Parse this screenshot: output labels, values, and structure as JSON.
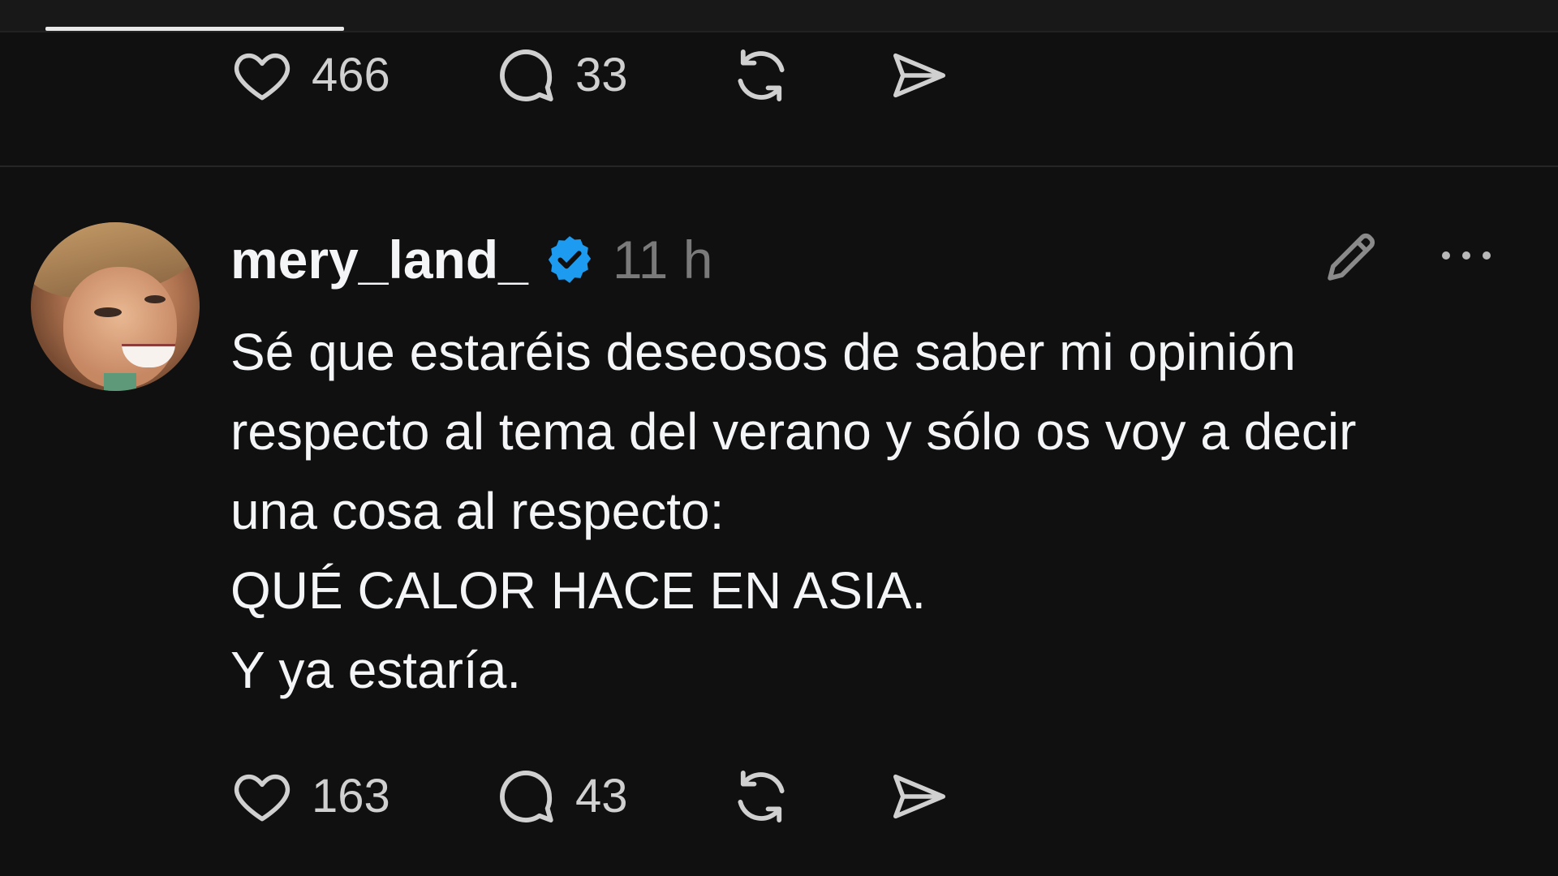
{
  "previous_post": {
    "likes": "466",
    "replies": "33"
  },
  "post": {
    "username": "mery_land_",
    "timestamp": "11 h",
    "lines": [
      "Sé que estaréis deseosos de saber mi opinión",
      "respecto al tema del verano y sólo os voy a decir",
      "una cosa al respecto:",
      "QUÉ CALOR HACE EN ASIA.",
      "Y ya estaría."
    ],
    "likes": "163",
    "replies": "43"
  },
  "icons": {
    "like": "heart-icon",
    "reply": "comment-bubble-icon",
    "repost": "repost-icon",
    "share": "send-icon",
    "edit": "pencil-icon",
    "more": "more-dots-icon",
    "verified": "verified-badge-icon"
  },
  "colors": {
    "background": "#101010",
    "text": "#f3f5f7",
    "muted": "#7a7a7a",
    "verified": "#1d9bf0"
  }
}
